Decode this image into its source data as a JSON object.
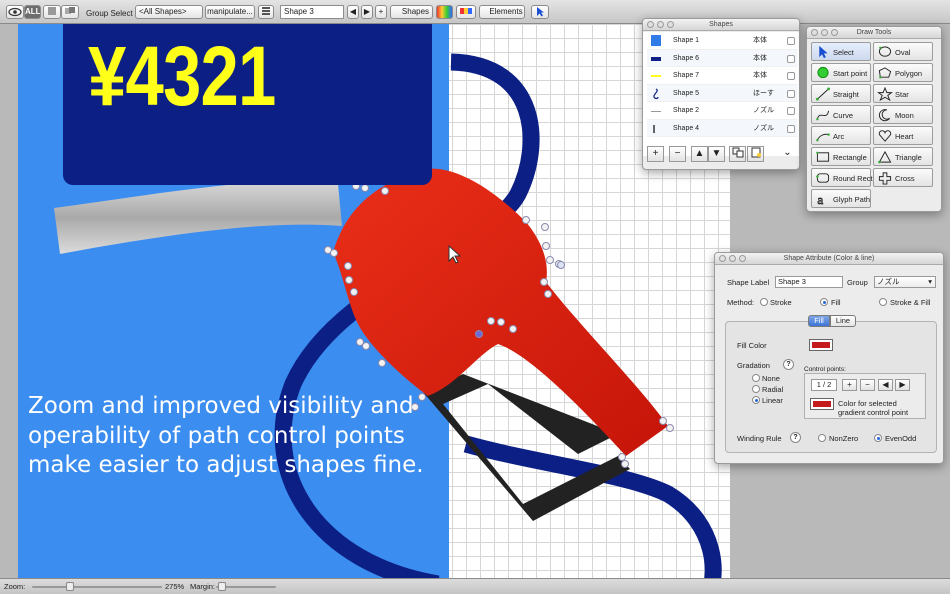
{
  "toolbar": {
    "view_all": "ALL",
    "group_select_label": "Group Select",
    "group_select_value": "<All Shapes>",
    "manipulate_label": "manipulate...",
    "shape_name": "Shape 3",
    "prev": "◀",
    "next": "▶",
    "add": "+",
    "shapes_label": "Shapes",
    "elements_label": "Elements"
  },
  "canvas": {
    "price": "¥4321",
    "caption": "Zoom and improved visibility and operability of path control points make easier to adjust shapes fine."
  },
  "statusbar": {
    "zoom_label": "Zoom:",
    "zoom_value": "275%",
    "margin_label": "Margin:"
  },
  "shapes_window": {
    "title": "Shapes",
    "rows": [
      {
        "name": "Shape 1",
        "group": "本体",
        "color": "#2f7be8"
      },
      {
        "name": "Shape 6",
        "group": "本体",
        "color": "#0c1f85"
      },
      {
        "name": "Shape 7",
        "group": "本体",
        "color": "#ffff1a"
      },
      {
        "name": "Shape 5",
        "group": "ほーす",
        "color": "#0c1f85"
      },
      {
        "name": "Shape 2",
        "group": "ノズル",
        "color": "#999999"
      },
      {
        "name": "Shape 4",
        "group": "ノズル",
        "color": "#333333"
      }
    ],
    "add_btn": "+",
    "remove_btn": "−",
    "up_btn": "▲",
    "down_btn": "▼",
    "more_btn": "⌄"
  },
  "draw_tools": {
    "title": "Draw Tools",
    "tools": [
      "Select",
      "Oval",
      "Start point",
      "Polygon",
      "Straight",
      "Star",
      "Curve",
      "Moon",
      "Arc",
      "Heart",
      "Rectangle",
      "Triangle",
      "Round Rect",
      "Cross",
      "Glyph Path"
    ],
    "icons": [
      "arrow-cursor-icon",
      "oval-icon",
      "start-point-icon",
      "polygon-icon",
      "straight-line-icon",
      "star-icon",
      "curve-icon",
      "moon-icon",
      "arc-icon",
      "heart-icon",
      "rectangle-icon",
      "triangle-icon",
      "round-rect-icon",
      "cross-icon",
      "glyph-path-icon"
    ]
  },
  "attr_window": {
    "title": "Shape Attribute (Color & line)",
    "shape_label": "Shape Label",
    "shape_label_value": "Shape 3",
    "group_label": "Group",
    "group_value": "ノズル",
    "method_label": "Method:",
    "method_stroke": "Stroke",
    "method_fill": "Fill",
    "method_stroke_fill": "Stroke & Fill",
    "tab_fill": "Fill",
    "tab_line": "Line",
    "fill_color_label": "Fill Color",
    "fill_color": "#c41c1c",
    "gradation_label": "Gradation",
    "grad_none": "None",
    "grad_radial": "Radial",
    "grad_linear": "Linear",
    "control_points_label": "Control points:",
    "control_points_value": "1 / 2",
    "cp_add": "+",
    "cp_remove": "−",
    "cp_prev": "◀",
    "cp_next": "▶",
    "color_for_selected": "Color for selected gradient control point",
    "winding_label": "Winding Rule",
    "wind_nonzero": "NonZero",
    "wind_evenodd": "EvenOdd",
    "help": "?"
  },
  "colors": {
    "canvas_blue": "#3b8df0",
    "price_box": "#0c1f85",
    "price_text": "#ffff1a",
    "nozzle_red": "#e02a14",
    "hose_navy": "#0c1f85"
  }
}
